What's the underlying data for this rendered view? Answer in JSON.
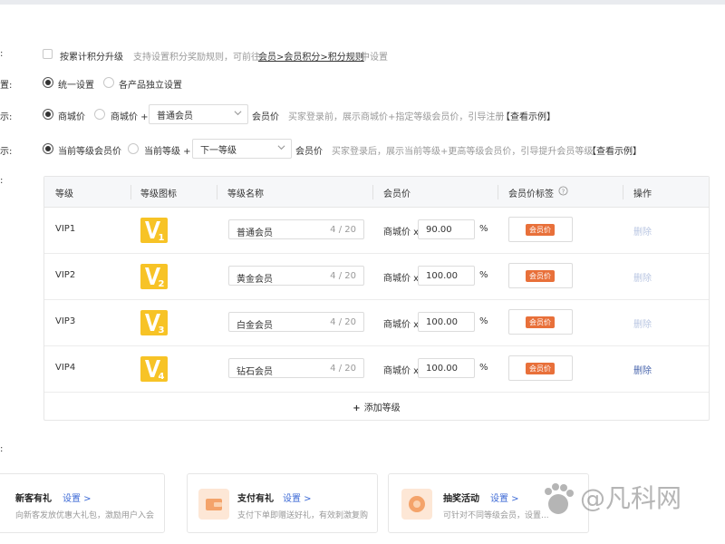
{
  "settings": {
    "row1": {
      "label": ":",
      "checkbox_label": "按累计积分升级",
      "hint_prefix": "支持设置积分奖励规则，可前往",
      "hint_link": "会员>会员积分>积分规则",
      "hint_suffix": "中设置"
    },
    "row2": {
      "label": "置:",
      "opt1": "统一设置",
      "opt2": "各产品独立设置"
    },
    "row3": {
      "label": "示:",
      "opt1": "商城价",
      "opt2": "商城价 +",
      "select_value": "普通会员",
      "after": "会员价",
      "hint": "买家登录前，展示商城价+指定等级会员价，引导注册",
      "example": "【查看示例】"
    },
    "row4": {
      "label": "示:",
      "opt1": "当前等级会员价",
      "opt2": "当前等级 +",
      "select_value": "下一等级",
      "after": "会员价",
      "hint": "买家登录后，展示当前等级+更高等级会员价，引导提升会员等级",
      "example": "【查看示例】"
    },
    "row5": {
      "label": ":"
    }
  },
  "table": {
    "headers": {
      "level": "等级",
      "icon": "等级图标",
      "name": "等级名称",
      "price": "会员价",
      "tag": "会员价标签",
      "op": "操作"
    },
    "rows": [
      {
        "level": "VIP1",
        "digit": "1",
        "name": "普通会员",
        "count": "4 / 20",
        "price_label": "商城价 x",
        "price": "90.00",
        "pct": "%",
        "tag": "会员价",
        "action": "删除"
      },
      {
        "level": "VIP2",
        "digit": "2",
        "name": "黄金会员",
        "count": "4 / 20",
        "price_label": "商城价 x",
        "price": "100.00",
        "pct": "%",
        "tag": "会员价",
        "action": "删除"
      },
      {
        "level": "VIP3",
        "digit": "3",
        "name": "白金会员",
        "count": "4 / 20",
        "price_label": "商城价 x",
        "price": "100.00",
        "pct": "%",
        "tag": "会员价",
        "action": "删除"
      },
      {
        "level": "VIP4",
        "digit": "4",
        "name": "钻石会员",
        "count": "4 / 20",
        "price_label": "商城价 x",
        "price": "100.00",
        "pct": "%",
        "tag": "会员价",
        "action": "删除"
      }
    ],
    "add_level": "添加等级"
  },
  "section_label": ":",
  "cards": [
    {
      "title": "新客有礼",
      "link": "设置 >",
      "desc": "向新客发放优惠大礼包，激励用户入会"
    },
    {
      "title": "支付有礼",
      "link": "设置 >",
      "desc": "支付下单即赠送好礼，有效刺激复购"
    },
    {
      "title": "抽奖活动",
      "link": "设置 >",
      "desc": "可针对不同等级会员，设置..."
    }
  ],
  "watermark": "@凡科网",
  "colors": {
    "vip_yellow": "#f7c326",
    "tag_orange": "#e8703a",
    "link_blue": "#3d6ad6",
    "delete_blue": "#4a66ad"
  }
}
